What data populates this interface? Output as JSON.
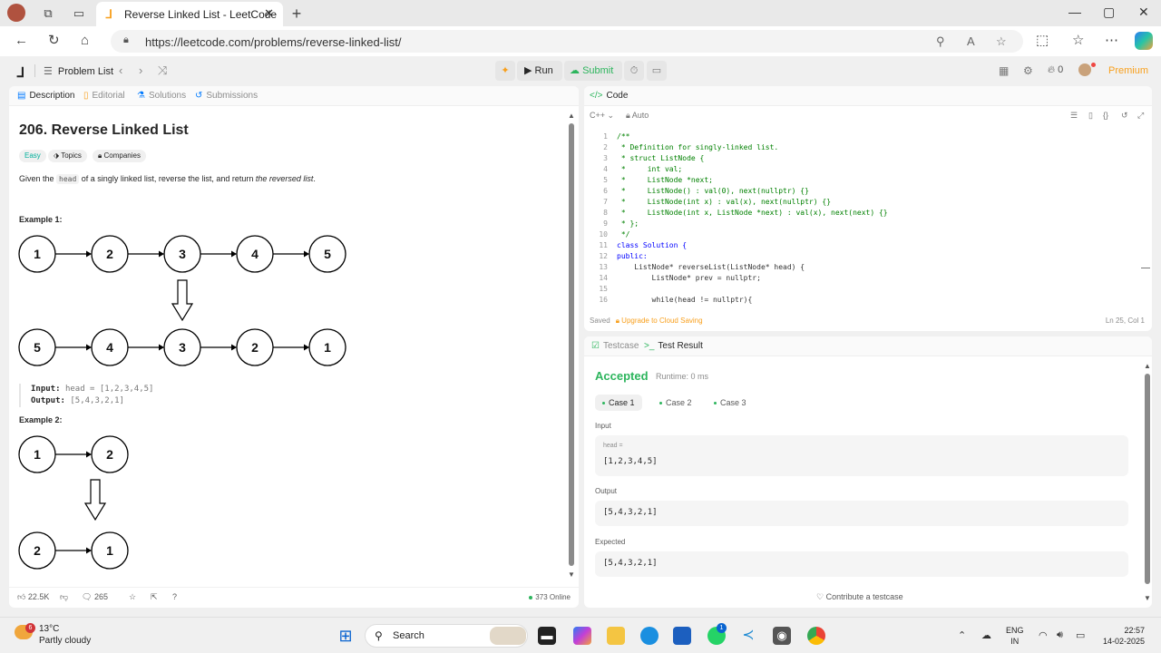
{
  "browser": {
    "tab_title": "Reverse Linked List - LeetCode",
    "url": "https://leetcode.com/problems/reverse-linked-list/"
  },
  "topbar": {
    "problem_list": "Problem List",
    "run": "Run",
    "submit": "Submit",
    "streak": "0",
    "premium": "Premium"
  },
  "left_tabs": [
    "Description",
    "Editorial",
    "Solutions",
    "Submissions"
  ],
  "problem": {
    "title": "206. Reverse Linked List",
    "difficulty": "Easy",
    "topics": "Topics",
    "companies": "Companies",
    "statement_pre": "Given the ",
    "statement_code": "head",
    "statement_mid": " of a singly linked list, reverse the list, and return ",
    "statement_em": "the reversed list",
    "statement_end": "."
  },
  "example1": {
    "title": "Example 1:",
    "top_nodes": [
      "1",
      "2",
      "3",
      "4",
      "5"
    ],
    "bottom_nodes": [
      "5",
      "4",
      "3",
      "2",
      "1"
    ],
    "input_label": "Input:",
    "input_value": "head = [1,2,3,4,5]",
    "output_label": "Output:",
    "output_value": "[5,4,3,2,1]"
  },
  "example2": {
    "title": "Example 2:",
    "top_nodes": [
      "1",
      "2"
    ],
    "bottom_nodes": [
      "2",
      "1"
    ]
  },
  "left_footer": {
    "likes": "22.5K",
    "comments": "265",
    "online": "373 Online"
  },
  "code_panel": {
    "title": "Code",
    "language": "C++",
    "mode": "Auto",
    "saved": "Saved",
    "upgrade": "Upgrade to Cloud Saving",
    "cursor": "Ln 25, Col 1",
    "lines": [
      {
        "n": "1",
        "t": "/**"
      },
      {
        "n": "2",
        "t": " * Definition for singly-linked list."
      },
      {
        "n": "3",
        "t": " * struct ListNode {"
      },
      {
        "n": "4",
        "t": " *     int val;"
      },
      {
        "n": "5",
        "t": " *     ListNode *next;"
      },
      {
        "n": "6",
        "t": " *     ListNode() : val(0), next(nullptr) {}"
      },
      {
        "n": "7",
        "t": " *     ListNode(int x) : val(x), next(nullptr) {}"
      },
      {
        "n": "8",
        "t": " *     ListNode(int x, ListNode *next) : val(x), next(next) {}"
      },
      {
        "n": "9",
        "t": " * };"
      },
      {
        "n": "10",
        "t": " */"
      },
      {
        "n": "11",
        "t": "class Solution {"
      },
      {
        "n": "12",
        "t": "public:"
      },
      {
        "n": "13",
        "t": "    ListNode* reverseList(ListNode* head) {"
      },
      {
        "n": "14",
        "t": "        ListNode* prev = nullptr;"
      },
      {
        "n": "15",
        "t": ""
      },
      {
        "n": "16",
        "t": "        while(head != nullptr){"
      }
    ]
  },
  "result_panel": {
    "tab_testcase": "Testcase",
    "tab_result": "Test Result",
    "status": "Accepted",
    "runtime": "Runtime: 0 ms",
    "cases": [
      "Case 1",
      "Case 2",
      "Case 3"
    ],
    "input_label": "Input",
    "input_key": "head =",
    "input_value": "[1,2,3,4,5]",
    "output_label": "Output",
    "output_value": "[5,4,3,2,1]",
    "expected_label": "Expected",
    "expected_value": "[5,4,3,2,1]",
    "contribute": "Contribute a testcase"
  },
  "taskbar": {
    "temperature": "13°C",
    "weather": "Partly cloudy",
    "weather_badge": "6",
    "search": "Search",
    "whatsapp_badge": "1",
    "lang_top": "ENG",
    "lang_bottom": "IN",
    "time": "22:57",
    "date": "14-02-2025"
  },
  "colors": {
    "accent_orange": "#f89f1b",
    "accepted_green": "#2db55d",
    "easy_teal": "#00af9b"
  }
}
